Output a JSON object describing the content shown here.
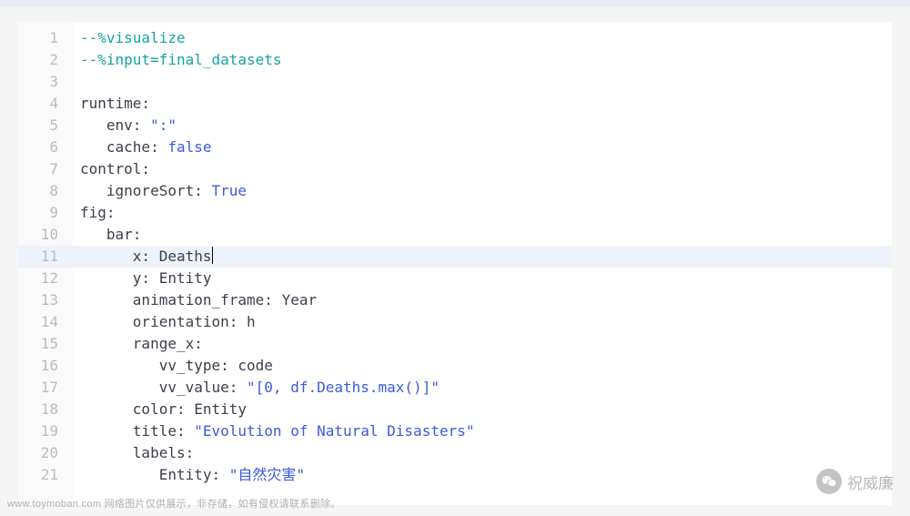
{
  "watermark": {
    "left": "www.toymoban.com 网络图片仅供展示，非存储，如有侵权请联系删除。",
    "right": "祝威廉"
  },
  "editor": {
    "cursorLine": 11,
    "lines": [
      {
        "n": 1,
        "tokens": [
          {
            "cls": "c-comment",
            "t": "--%visualize"
          }
        ]
      },
      {
        "n": 2,
        "tokens": [
          {
            "cls": "c-comment",
            "t": "--%input=final_datasets"
          }
        ]
      },
      {
        "n": 3,
        "tokens": []
      },
      {
        "n": 4,
        "tokens": [
          {
            "cls": "c-key",
            "t": "runtime:"
          }
        ]
      },
      {
        "n": 5,
        "tokens": [
          {
            "cls": "c-key",
            "t": "   env: "
          },
          {
            "cls": "c-string",
            "t": "\":\""
          }
        ]
      },
      {
        "n": 6,
        "tokens": [
          {
            "cls": "c-key",
            "t": "   cache: "
          },
          {
            "cls": "c-bool",
            "t": "false"
          }
        ]
      },
      {
        "n": 7,
        "tokens": [
          {
            "cls": "c-key",
            "t": "control:"
          }
        ]
      },
      {
        "n": 8,
        "tokens": [
          {
            "cls": "c-key",
            "t": "   ignoreSort: "
          },
          {
            "cls": "c-bool",
            "t": "True"
          }
        ]
      },
      {
        "n": 9,
        "tokens": [
          {
            "cls": "c-key",
            "t": "fig:"
          }
        ]
      },
      {
        "n": 10,
        "tokens": [
          {
            "cls": "c-key",
            "t": "   bar:"
          }
        ]
      },
      {
        "n": 11,
        "tokens": [
          {
            "cls": "c-key",
            "t": "      x: "
          },
          {
            "cls": "c-val",
            "t": "Deaths"
          }
        ],
        "cursorAfter": true
      },
      {
        "n": 12,
        "tokens": [
          {
            "cls": "c-key",
            "t": "      y: "
          },
          {
            "cls": "c-val",
            "t": "Entity"
          }
        ]
      },
      {
        "n": 13,
        "tokens": [
          {
            "cls": "c-key",
            "t": "      animation_frame: "
          },
          {
            "cls": "c-val",
            "t": "Year"
          }
        ]
      },
      {
        "n": 14,
        "tokens": [
          {
            "cls": "c-key",
            "t": "      orientation: "
          },
          {
            "cls": "c-val",
            "t": "h"
          }
        ]
      },
      {
        "n": 15,
        "tokens": [
          {
            "cls": "c-key",
            "t": "      range_x:"
          }
        ]
      },
      {
        "n": 16,
        "tokens": [
          {
            "cls": "c-key",
            "t": "         vv_type: "
          },
          {
            "cls": "c-val",
            "t": "code"
          }
        ]
      },
      {
        "n": 17,
        "tokens": [
          {
            "cls": "c-key",
            "t": "         vv_value: "
          },
          {
            "cls": "c-string",
            "t": "\"[0, df.Deaths.max()]\""
          }
        ]
      },
      {
        "n": 18,
        "tokens": [
          {
            "cls": "c-key",
            "t": "      color: "
          },
          {
            "cls": "c-val",
            "t": "Entity"
          }
        ]
      },
      {
        "n": 19,
        "tokens": [
          {
            "cls": "c-key",
            "t": "      title: "
          },
          {
            "cls": "c-string",
            "t": "\"Evolution of Natural Disasters\""
          }
        ]
      },
      {
        "n": 20,
        "tokens": [
          {
            "cls": "c-key",
            "t": "      labels:"
          }
        ]
      },
      {
        "n": 21,
        "tokens": [
          {
            "cls": "c-key",
            "t": "         Entity: "
          },
          {
            "cls": "c-string",
            "t": "\"自然灾害\""
          }
        ]
      }
    ]
  }
}
